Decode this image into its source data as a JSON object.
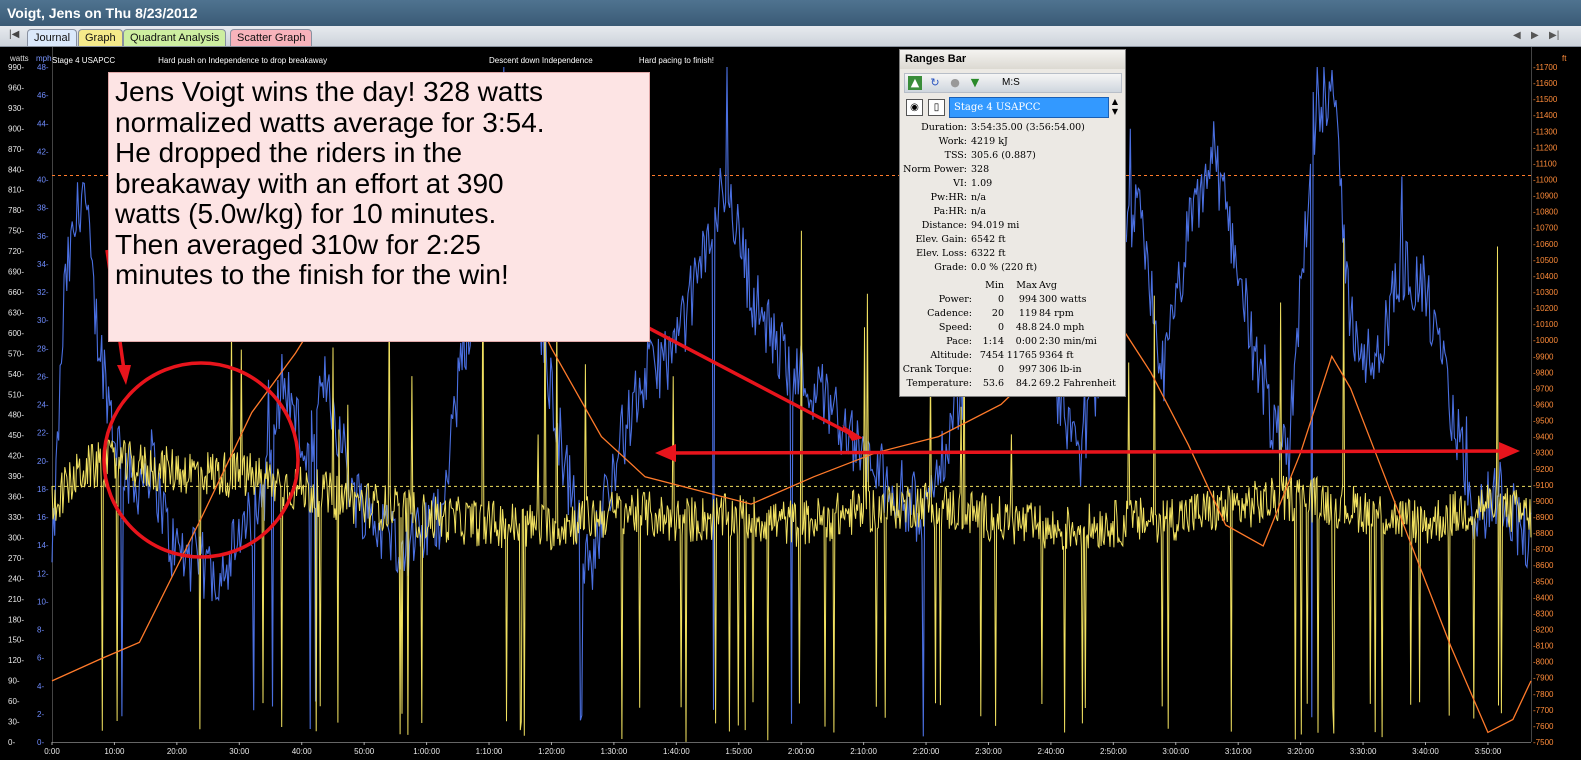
{
  "window": {
    "title": "Voigt, Jens on Thu 8/23/2012"
  },
  "tabs": [
    {
      "label": "Journal"
    },
    {
      "label": "Graph"
    },
    {
      "label": "Quadrant Analysis"
    },
    {
      "label": "Scatter Graph"
    }
  ],
  "colors": {
    "power": "#f0e060",
    "speed": "#4a6fe0",
    "altitude": "#ff7a2a",
    "annotation": "#e8141c",
    "callout_bg": "#fde4e4"
  },
  "graph": {
    "units": {
      "left1": "watts",
      "left2": "mph",
      "right": "ft"
    },
    "range_labels": [
      {
        "text": "Stage 4 USAPCC",
        "time_min": 0
      },
      {
        "text": "Hard push on Independence to drop breakaway",
        "time_min": 17
      },
      {
        "text": "Descent down Independence",
        "time_min": 70
      },
      {
        "text": "Hard pacing to finish!",
        "time_min": 94
      }
    ],
    "power_axis": {
      "min": 0,
      "max": 990,
      "step": 30
    },
    "speed_axis": {
      "min": 0,
      "max": 48,
      "step": 2
    },
    "altitude_axis": {
      "min": 7500,
      "max": 11700,
      "step": 100
    },
    "time_ticks": [
      "0:00",
      "10:00",
      "20:00",
      "30:00",
      "40:00",
      "50:00",
      "1:00:00",
      "1:10:00",
      "1:20:00",
      "1:30:00",
      "1:40:00",
      "1:50:00",
      "2:00:00",
      "2:10:00",
      "2:20:00",
      "2:30:00",
      "2:40:00",
      "2:50:00",
      "3:00:00",
      "3:10:00",
      "3:20:00",
      "3:30:00",
      "3:40:00",
      "3:50:00"
    ],
    "duration_min": 236.9,
    "reference_lines": {
      "power_watts": 375,
      "altitude_ft": 11025
    },
    "callout": "Jens Voigt wins the day! 328 watts\nnormalized watts average for 3:54.\nHe dropped the riders in the\nbreakaway with an effort at 390\nwatts (5.0w/kg) for 10 minutes.\nThen averaged 310w for 2:25\nminutes to the finish for the win!",
    "altitude_profile": [
      {
        "t": 0,
        "alt": 7880
      },
      {
        "t": 8,
        "alt": 8020
      },
      {
        "t": 14,
        "alt": 8120
      },
      {
        "t": 24,
        "alt": 8900
      },
      {
        "t": 32,
        "alt": 9550
      },
      {
        "t": 39,
        "alt": 9920
      },
      {
        "t": 48,
        "alt": 10480
      },
      {
        "t": 56,
        "alt": 10960
      },
      {
        "t": 63,
        "alt": 11100
      },
      {
        "t": 66,
        "alt": 11000
      },
      {
        "t": 72,
        "alt": 10600
      },
      {
        "t": 80,
        "alt": 9950
      },
      {
        "t": 88,
        "alt": 9400
      },
      {
        "t": 95,
        "alt": 9150
      },
      {
        "t": 105,
        "alt": 9050
      },
      {
        "t": 112,
        "alt": 8980
      },
      {
        "t": 122,
        "alt": 9150
      },
      {
        "t": 132,
        "alt": 9300
      },
      {
        "t": 142,
        "alt": 9400
      },
      {
        "t": 152,
        "alt": 9600
      },
      {
        "t": 160,
        "alt": 9900
      },
      {
        "t": 167,
        "alt": 10300
      },
      {
        "t": 171,
        "alt": 10100
      },
      {
        "t": 176,
        "alt": 9800
      },
      {
        "t": 182,
        "alt": 9350
      },
      {
        "t": 188,
        "alt": 8850
      },
      {
        "t": 194,
        "alt": 8720
      },
      {
        "t": 200,
        "alt": 9300
      },
      {
        "t": 205,
        "alt": 9900
      },
      {
        "t": 208,
        "alt": 9700
      },
      {
        "t": 212,
        "alt": 9300
      },
      {
        "t": 218,
        "alt": 8700
      },
      {
        "t": 224,
        "alt": 8100
      },
      {
        "t": 230,
        "alt": 7560
      },
      {
        "t": 234,
        "alt": 7640
      },
      {
        "t": 236.9,
        "alt": 7880
      }
    ],
    "speed_profile": [
      {
        "t": 0,
        "v": 12
      },
      {
        "t": 2,
        "v": 32
      },
      {
        "t": 5,
        "v": 40
      },
      {
        "t": 7,
        "v": 30
      },
      {
        "t": 10,
        "v": 22
      },
      {
        "t": 13,
        "v": 18
      },
      {
        "t": 16,
        "v": 20
      },
      {
        "t": 19,
        "v": 14
      },
      {
        "t": 22,
        "v": 13
      },
      {
        "t": 26,
        "v": 12
      },
      {
        "t": 30,
        "v": 14
      },
      {
        "t": 34,
        "v": 18
      },
      {
        "t": 37,
        "v": 26
      },
      {
        "t": 41,
        "v": 20
      },
      {
        "t": 44,
        "v": 26
      },
      {
        "t": 48,
        "v": 18
      },
      {
        "t": 53,
        "v": 15
      },
      {
        "t": 58,
        "v": 14
      },
      {
        "t": 62,
        "v": 16
      },
      {
        "t": 66,
        "v": 28
      },
      {
        "t": 70,
        "v": 37
      },
      {
        "t": 74,
        "v": 40
      },
      {
        "t": 78,
        "v": 30
      },
      {
        "t": 82,
        "v": 20
      },
      {
        "t": 86,
        "v": 12
      },
      {
        "t": 90,
        "v": 20
      },
      {
        "t": 95,
        "v": 26
      },
      {
        "t": 100,
        "v": 28
      },
      {
        "t": 104,
        "v": 34
      },
      {
        "t": 108,
        "v": 40
      },
      {
        "t": 112,
        "v": 32
      },
      {
        "t": 116,
        "v": 28
      },
      {
        "t": 120,
        "v": 26
      },
      {
        "t": 125,
        "v": 24
      },
      {
        "t": 130,
        "v": 20
      },
      {
        "t": 135,
        "v": 18
      },
      {
        "t": 140,
        "v": 16
      },
      {
        "t": 145,
        "v": 24
      },
      {
        "t": 150,
        "v": 32
      },
      {
        "t": 155,
        "v": 42
      },
      {
        "t": 160,
        "v": 26
      },
      {
        "t": 165,
        "v": 20
      },
      {
        "t": 170,
        "v": 32
      },
      {
        "t": 174,
        "v": 38
      },
      {
        "t": 178,
        "v": 26
      },
      {
        "t": 182,
        "v": 36
      },
      {
        "t": 186,
        "v": 42
      },
      {
        "t": 190,
        "v": 34
      },
      {
        "t": 194,
        "v": 24
      },
      {
        "t": 198,
        "v": 20
      },
      {
        "t": 202,
        "v": 44
      },
      {
        "t": 205,
        "v": 47
      },
      {
        "t": 208,
        "v": 30
      },
      {
        "t": 212,
        "v": 26
      },
      {
        "t": 216,
        "v": 34
      },
      {
        "t": 220,
        "v": 32
      },
      {
        "t": 224,
        "v": 24
      },
      {
        "t": 228,
        "v": 16
      },
      {
        "t": 232,
        "v": 18
      },
      {
        "t": 236.9,
        "v": 14
      }
    ],
    "power_profile": [
      {
        "t": 0,
        "w": 350
      },
      {
        "t": 5,
        "w": 400
      },
      {
        "t": 10,
        "w": 410
      },
      {
        "t": 17,
        "w": 400
      },
      {
        "t": 25,
        "w": 395
      },
      {
        "t": 32,
        "w": 390
      },
      {
        "t": 40,
        "w": 370
      },
      {
        "t": 50,
        "w": 350
      },
      {
        "t": 60,
        "w": 330
      },
      {
        "t": 70,
        "w": 320
      },
      {
        "t": 80,
        "w": 315
      },
      {
        "t": 92,
        "w": 340
      },
      {
        "t": 100,
        "w": 325
      },
      {
        "t": 110,
        "w": 330
      },
      {
        "t": 120,
        "w": 320
      },
      {
        "t": 130,
        "w": 340
      },
      {
        "t": 140,
        "w": 350
      },
      {
        "t": 150,
        "w": 330
      },
      {
        "t": 160,
        "w": 310
      },
      {
        "t": 170,
        "w": 320
      },
      {
        "t": 180,
        "w": 330
      },
      {
        "t": 190,
        "w": 345
      },
      {
        "t": 200,
        "w": 360
      },
      {
        "t": 210,
        "w": 340
      },
      {
        "t": 220,
        "w": 320
      },
      {
        "t": 230,
        "w": 350
      },
      {
        "t": 236.9,
        "w": 330
      }
    ]
  },
  "ranges_bar": {
    "title": "Ranges Bar",
    "mode_label": "M:S",
    "range_name": "Stage 4 USAPCC",
    "stats": [
      {
        "label": "Duration:",
        "value": "3:54:35.00 (3:56:54.00)"
      },
      {
        "label": "Work:",
        "value": "4219 kJ"
      },
      {
        "label": "TSS:",
        "value": "305.6 (0.887)"
      },
      {
        "label": "Norm Power:",
        "value": "328"
      },
      {
        "label": "VI:",
        "value": "1.09"
      },
      {
        "label": "Pw:HR:",
        "value": "n/a"
      },
      {
        "label": "Pa:HR:",
        "value": "n/a"
      },
      {
        "label": "Distance:",
        "value": "94.019 mi"
      },
      {
        "label": "Elev. Gain:",
        "value": "6542 ft"
      },
      {
        "label": "Elev. Loss:",
        "value": "6322 ft"
      },
      {
        "label": "Grade:",
        "value": "0.0 % (220 ft)"
      }
    ],
    "table_header": {
      "min": "Min",
      "max": "Max",
      "avg": "Avg"
    },
    "table": [
      {
        "label": "Power:",
        "min": "0",
        "max": "994",
        "avg": "300 watts"
      },
      {
        "label": "Cadence:",
        "min": "20",
        "max": "119",
        "avg": "84 rpm"
      },
      {
        "label": "Speed:",
        "min": "0",
        "max": "48.8",
        "avg": "24.0 mph"
      },
      {
        "label": "Pace:",
        "min": "1:14",
        "max": "0:00",
        "avg": "2:30 min/mi"
      },
      {
        "label": "Altitude:",
        "min": "7454",
        "max": "11765",
        "avg": "9364 ft"
      },
      {
        "label": "Crank Torque:",
        "min": "0",
        "max": "997",
        "avg": "306 lb-in"
      },
      {
        "label": "Temperature:",
        "min": "53.6",
        "max": "84.2",
        "avg": "69.2 Fahrenheit"
      }
    ]
  }
}
